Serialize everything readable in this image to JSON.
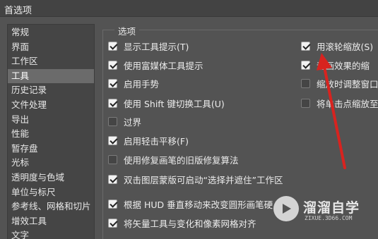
{
  "window": {
    "title": "首选项"
  },
  "sidebar": {
    "items": [
      {
        "label": "常规",
        "active": false
      },
      {
        "label": "界面",
        "active": false
      },
      {
        "label": "工作区",
        "active": false
      },
      {
        "label": "工具",
        "active": true
      },
      {
        "label": "历史记录",
        "active": false
      },
      {
        "label": "文件处理",
        "active": false
      },
      {
        "label": "导出",
        "active": false
      },
      {
        "label": "性能",
        "active": false
      },
      {
        "label": "暂存盘",
        "active": false
      },
      {
        "label": "光标",
        "active": false
      },
      {
        "label": "透明度与色域",
        "active": false
      },
      {
        "label": "单位与标尺",
        "active": false
      },
      {
        "label": "参考线、网格和切片",
        "active": false
      },
      {
        "label": "增效工具",
        "active": false
      },
      {
        "label": "文字",
        "active": false
      }
    ]
  },
  "options": {
    "group_title": "选项",
    "left": [
      {
        "label": "显示工具提示(T)",
        "checked": true
      },
      {
        "label": "使用富媒体工具提示",
        "checked": true
      },
      {
        "label": "启用手势",
        "checked": true
      },
      {
        "label": "使用 Shift 键切换工具(U)",
        "checked": true
      },
      {
        "label": "过界",
        "checked": false
      },
      {
        "label": "启用轻击平移(F)",
        "checked": true
      },
      {
        "label": "使用修复画笔的旧版修复算法",
        "checked": false
      },
      {
        "label": "双击图层蒙版可启动“选择并遮住”工作区",
        "checked": true
      },
      {
        "label": "根据 HUD 垂直移动来改变圆形画笔硬",
        "checked": true
      },
      {
        "label": "将矢量工具与变化和像素网格对齐",
        "checked": true
      }
    ],
    "right": [
      {
        "label": "用滚轮缩放(S)",
        "checked": true
      },
      {
        "label": "动画效果的缩",
        "checked": true
      },
      {
        "label": "缩放时调整窗口",
        "checked": false
      },
      {
        "label": "将单击点缩放至",
        "checked": false
      }
    ]
  },
  "watermark": {
    "name": "溜溜自学",
    "url": "ZIXUE.3D66.COM"
  },
  "colors": {
    "annotation_arrow": "#d8231f",
    "window_bg": "#535353",
    "sidebar_active": "#6b6b6b"
  }
}
